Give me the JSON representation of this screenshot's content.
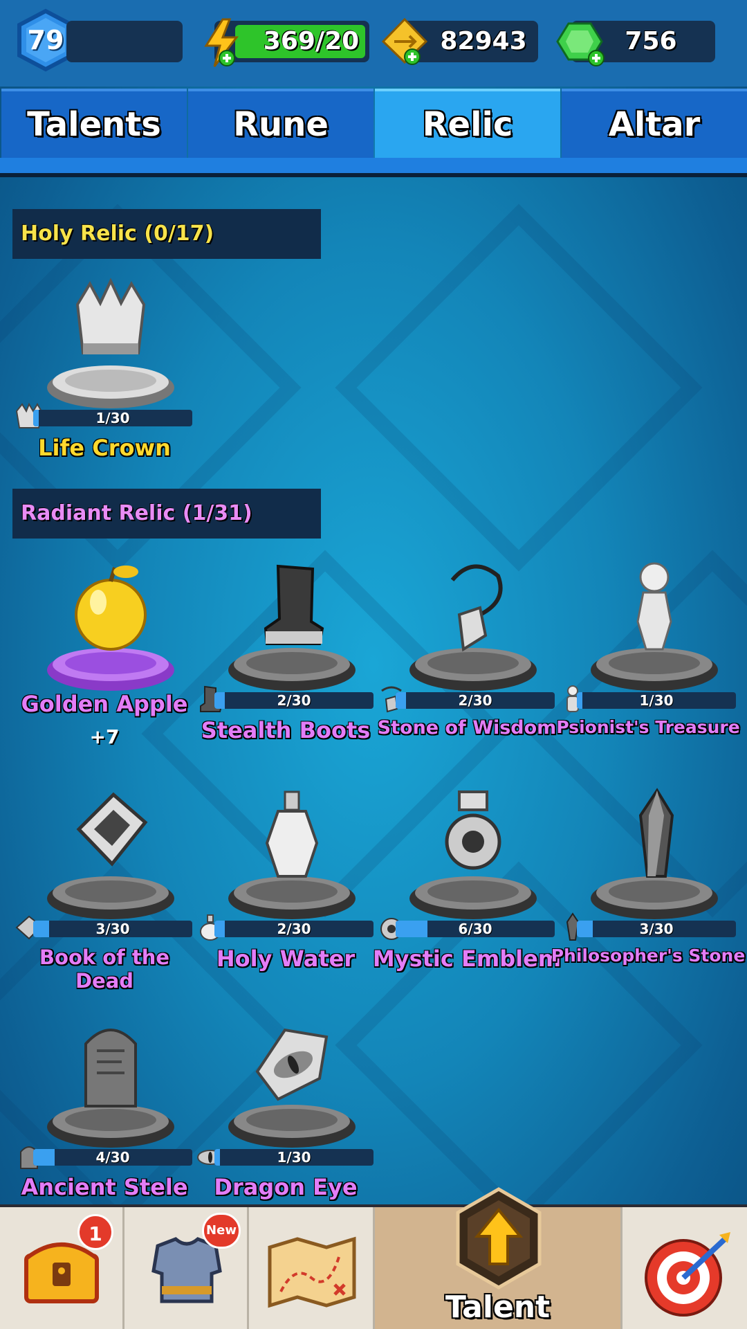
{
  "resources": {
    "level": "79",
    "energy": "369/20",
    "gold": "82943",
    "gems": "756"
  },
  "tabs": [
    {
      "label": "Talents",
      "active": false
    },
    {
      "label": "Rune",
      "active": false
    },
    {
      "label": "Relic",
      "active": true
    },
    {
      "label": "Altar",
      "active": false
    }
  ],
  "holy_section": {
    "title": "Holy Relic (0/17)",
    "items": [
      {
        "name": "Life Crown",
        "progress": "1/30",
        "fill": 0.033,
        "icon": "crown-icon"
      }
    ]
  },
  "radiant_section": {
    "title": "Radiant Relic (1/31)",
    "items": [
      {
        "name": "Golden Apple",
        "bonus": "+7",
        "icon": "golden-apple-icon",
        "owned": true
      },
      {
        "name": "Stealth Boots",
        "progress": "2/30",
        "fill": 0.067,
        "icon": "boot-icon"
      },
      {
        "name": "Stone of Wisdom",
        "progress": "2/30",
        "fill": 0.067,
        "icon": "necklace-icon"
      },
      {
        "name": "Psionist's Treasure",
        "progress": "1/30",
        "fill": 0.033,
        "icon": "figurine-icon"
      },
      {
        "name": "Book of the Dead",
        "progress": "3/30",
        "fill": 0.1,
        "icon": "book-icon"
      },
      {
        "name": "Holy Water",
        "progress": "2/30",
        "fill": 0.067,
        "icon": "potion-icon"
      },
      {
        "name": "Mystic Emblem",
        "progress": "6/30",
        "fill": 0.2,
        "icon": "emblem-icon"
      },
      {
        "name": "Philosopher's Stone",
        "progress": "3/30",
        "fill": 0.1,
        "icon": "crystal-icon"
      },
      {
        "name": "Ancient Stele",
        "progress": "4/30",
        "fill": 0.133,
        "icon": "gravestone-icon"
      },
      {
        "name": "Dragon Eye",
        "progress": "1/30",
        "fill": 0.033,
        "icon": "dragon-eye-icon"
      }
    ]
  },
  "bottom_nav": {
    "chest_badge": "1",
    "equipment_badge": "New",
    "talent_label": "Talent"
  },
  "colors": {
    "holy_title": "#f7e34b",
    "radiant_title": "#e98cf5",
    "active_tab": "#2aa6f0",
    "tab": "#1767c7"
  }
}
